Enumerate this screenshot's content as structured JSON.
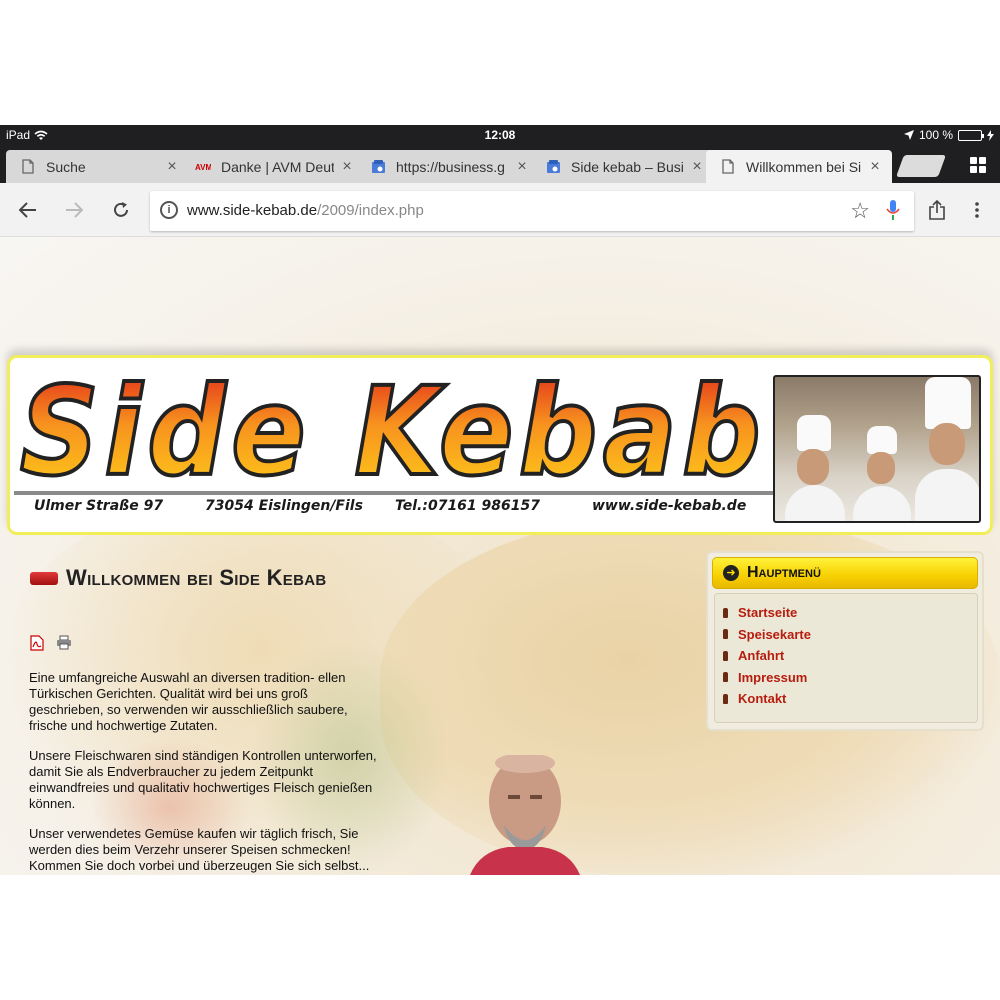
{
  "status_bar": {
    "device": "iPad",
    "time": "12:08",
    "battery": "100 %"
  },
  "tabs": [
    {
      "title": "Suche",
      "favicon": "page-icon",
      "active": false
    },
    {
      "title": "Danke | AVM Deuts",
      "favicon": "avm-icon",
      "active": false
    },
    {
      "title": "https://business.g",
      "favicon": "google-business-icon",
      "active": false
    },
    {
      "title": "Side kebab – Busi",
      "favicon": "google-business-icon",
      "active": false
    },
    {
      "title": "Willkommen bei Si",
      "favicon": "page-icon",
      "active": true
    }
  ],
  "omnibox": {
    "host": "www.side-kebab.de",
    "path": "/2009/index.php"
  },
  "banner": {
    "logo_text": "Side Kebab",
    "street": "Ulmer Straße 97",
    "city": "73054 Eislingen/Fils",
    "phone": "Tel.:07161 986157",
    "web": "www.side-kebab.de"
  },
  "content": {
    "title": "Willkommen bei Side Kebab",
    "paragraphs": [
      "Eine umfangreiche Auswahl an diversen tradition- ellen Türkischen Gerichten. Qualität wird bei uns groß geschrieben, so verwenden wir ausschließlich saubere, frische und hochwertige Zutaten.",
      "Unsere Fleischwaren sind ständigen Kontrollen unterworfen, damit Sie als Endverbraucher zu jedem Zeitpunkt einwandfreies und qualitativ hochwertiges Fleisch genießen können.",
      "Unser verwendetes Gemüse kaufen wir täglich frisch, Sie werden dies beim Verzehr unserer Speisen schmecken! Kommen Sie doch vorbei und überzeugen Sie sich selbst..."
    ]
  },
  "menu": {
    "title": "Hauptmenü",
    "items": [
      "Startseite",
      "Speisekarte",
      "Anfahrt",
      "Impressum",
      "Kontakt"
    ]
  },
  "colors": {
    "menu_link": "#b71d0e",
    "menu_header": "#f7d000",
    "banner_border": "#f2ee5a",
    "battery": "#4cd964"
  }
}
